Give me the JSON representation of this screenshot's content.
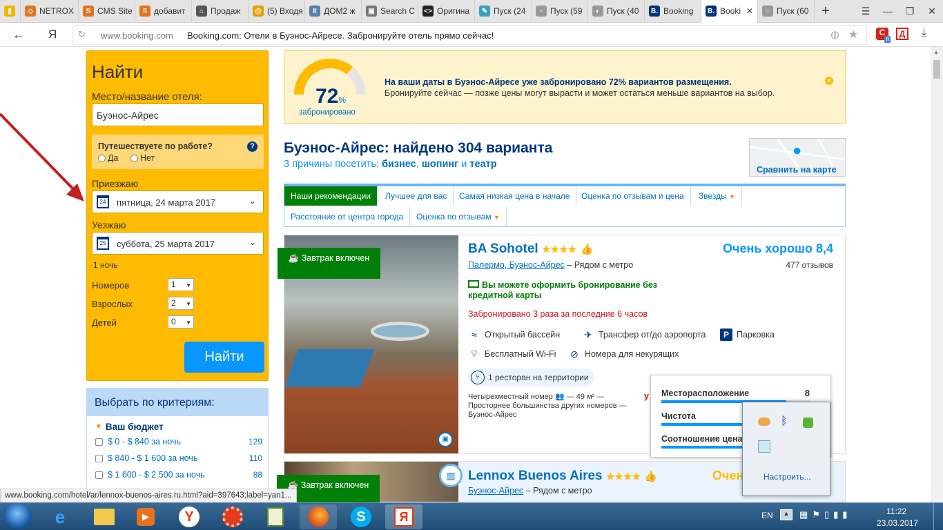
{
  "browser": {
    "tabs": [
      {
        "label": "",
        "color": "#f4b400",
        "glyph": "▮"
      },
      {
        "label": "NETROX",
        "color": "#e8711c",
        "glyph": "◇"
      },
      {
        "label": "CMS Site",
        "color": "#e8711c",
        "glyph": "S"
      },
      {
        "label": "добавит",
        "color": "#e8711c",
        "glyph": "S"
      },
      {
        "label": "Продаж",
        "color": "#555555",
        "glyph": "⌂"
      },
      {
        "label": "(5) Входя",
        "color": "#e8a200",
        "glyph": "@"
      },
      {
        "label": "ДОМ2 ж",
        "color": "#5c7ea8",
        "glyph": "II"
      },
      {
        "label": "Search C",
        "color": "#777777",
        "glyph": "▣"
      },
      {
        "label": "Оригина",
        "color": "#222222",
        "glyph": "<>"
      },
      {
        "label": "Пуск (24",
        "color": "#3aa0c0",
        "glyph": "✎"
      },
      {
        "label": "Пуск (59",
        "color": "#999999",
        "glyph": "·"
      },
      {
        "label": "Пуск (40",
        "color": "#999999",
        "glyph": "◐"
      },
      {
        "label": "Booking",
        "color": "#003580",
        "glyph": "B."
      },
      {
        "label": "Booki",
        "color": "#003580",
        "glyph": "B.",
        "active": true
      },
      {
        "label": "Пуск (60",
        "color": "#999999",
        "glyph": "◌"
      }
    ],
    "new_tab": "+",
    "url_domain": "www.booking.com",
    "url_title": "Booking.com: Отели в Буэнос-Айресе. Забронируйте отель прямо сейчас!",
    "yandex_logo": "Я",
    "ext_badge": "8"
  },
  "search": {
    "title": "Найти",
    "place_label": "Место/название отеля:",
    "place_value": "Буэнос-Айрес",
    "work_question": "Путешествуете по работе?",
    "work_yes": "Да",
    "work_no": "Нет",
    "checkin_label": "Приезжаю",
    "checkin_day": "24",
    "checkin_value": "пятница, 24 марта 2017",
    "checkout_label": "Уезжаю",
    "checkout_day": "25",
    "checkout_value": "суббота, 25 марта 2017",
    "nights": "1 ночь",
    "rooms_label": "Номеров",
    "rooms_value": "1",
    "adults_label": "Взрослых",
    "adults_value": "2",
    "children_label": "Детей",
    "children_value": "0",
    "button": "Найти"
  },
  "filters": {
    "title": "Выбрать по критериям:",
    "budget_title": "Ваш бюджет",
    "items": [
      {
        "label": "$ 0 - $ 840 за ночь",
        "count": "129"
      },
      {
        "label": "$ 840 - $ 1 600 за ночь",
        "count": "110"
      },
      {
        "label": "$ 1 600 - $ 2 500 за ночь",
        "count": "88"
      }
    ]
  },
  "banner": {
    "percent": "72",
    "percent_sign": "%",
    "percent_label": "забронировано",
    "percent_value": 0.72,
    "headline": "На ваши даты в Буэнос-Айресе уже забронировано 72% вариантов размещения.",
    "text": "Бронируйте сейчас — позже цены могут вырасти и может остаться меньше вариантов на выбор."
  },
  "results": {
    "heading": "Буэнос-Айрес: найдено 304 варианта",
    "reasons_prefix": "3 причины посетить:",
    "reason1": "бизнес",
    "comma": ",",
    "reason2": "шопинг",
    "and": "и",
    "reason3": "театр",
    "map_label": "Сравнить на карте"
  },
  "sort": {
    "tabs": [
      "Наши рекомендации",
      "Лучшее для вас",
      "Самая низкая цена в начале",
      "Оценка по отзывам и цена",
      "Звезды"
    ],
    "tabs2": [
      "Расстояние от центра города",
      "Оценка по отзывам"
    ]
  },
  "hotel1": {
    "badge": "Завтрак включен",
    "name": "BA Sohotel",
    "stars": "★★★★",
    "location": "Палермо, Буэнос-Айрес",
    "location_suffix": " – Рядом с метро",
    "score_label": "Очень хорошо 8,4",
    "reviews": "477 отзывов",
    "no_card": "Вы можете оформить бронирование без кредитной карты",
    "booked": "Забронировано 3 раза за последние 6 часов",
    "facilities": [
      "Открытый бассейн",
      "Трансфер от/до аэропорта",
      "Парковка",
      "Бесплатный Wi-Fi",
      "Номера для некурящих"
    ],
    "restaurant": "1 ресторан на территории",
    "room_desc": "Четырехместный номер",
    "room_size": "— 49 м² —",
    "room_desc2": "Просторнее большинства других номеров — Буэнос-Айрес",
    "price_fragment": "у"
  },
  "popup": {
    "rows": [
      {
        "label": "Месторасположение",
        "value": "8"
      },
      {
        "label": "Чистота",
        "value": ""
      },
      {
        "label": "Соотношение цена",
        "value": ""
      }
    ]
  },
  "hotel2": {
    "badge": "Завтрак включен",
    "name": "Lennox Buenos Aires",
    "stars": "★★★★",
    "location": "Буэнос-Айрес",
    "location_suffix": " – Рядом с метро",
    "score_fragment": "Очен"
  },
  "tray_popup": {
    "customize": "Настроить..."
  },
  "status_url": "www.booking.com/hotel/ar/lennox-buenos-aires.ru.html?aid=397643;label=yan1...",
  "taskbar": {
    "lang": "EN",
    "time": "11:22",
    "date": "23.03.2017"
  }
}
